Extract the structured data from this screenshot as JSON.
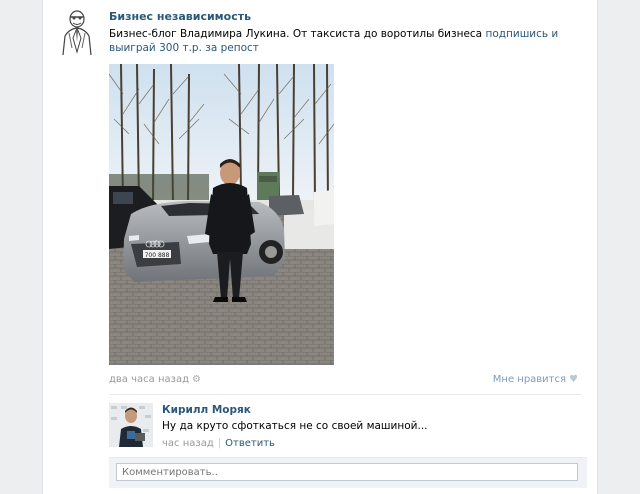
{
  "post": {
    "author": "Бизнес независимость",
    "text_plain": "Бизнес-блог Владимира Лукина. От таксиста до воротилы бизнеса ",
    "link_text": "подпишись и выиграй 300 т.р. за репост",
    "time": "два часа назад",
    "like_label": "Мне нравится"
  },
  "comment": {
    "author": "Кирилл Моряк",
    "text": "Ну да круто сфоткаться не со своей машиной...",
    "time": "час назад",
    "separator": "|",
    "reply_label": "Ответить"
  },
  "reply_box": {
    "placeholder": "Комментировать.."
  },
  "photo": {
    "plate": "700 888"
  },
  "icons": {
    "settings": "gear-icon",
    "like": "heart-icon"
  },
  "colors": {
    "link": "#2b587a",
    "muted": "#999999",
    "background": "#edeef0"
  }
}
